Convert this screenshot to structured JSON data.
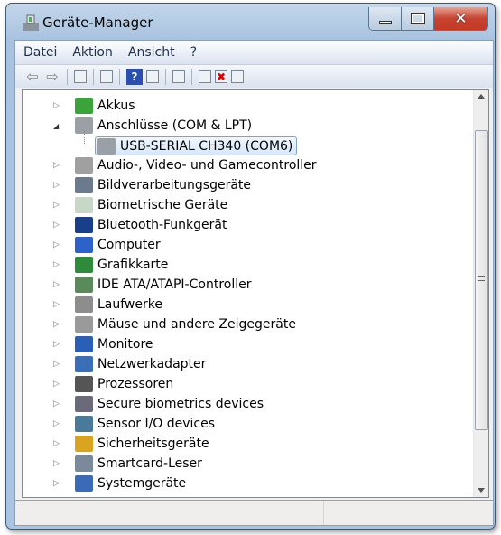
{
  "window": {
    "title": "Geräte-Manager"
  },
  "menu": [
    "Datei",
    "Aktion",
    "Ansicht",
    "?"
  ],
  "toolbar": [
    "back-icon",
    "forward-icon",
    "show-hide-console-tree-icon",
    "properties-icon",
    "help-icon",
    "show-action-pane-icon",
    "scan-hardware-icon",
    "update-driver-icon",
    "uninstall-icon",
    "disable-icon"
  ],
  "tree": [
    {
      "label": "Akkus",
      "expanded": false,
      "icon": "battery-icon",
      "color": "#3aa43a"
    },
    {
      "label": "Anschlüsse (COM & LPT)",
      "expanded": true,
      "icon": "port-icon",
      "color": "#9aa0a6",
      "children": [
        {
          "label": "USB-SERIAL CH340 (COM6)",
          "selected": true
        }
      ]
    },
    {
      "label": "Audio-, Video- und Gamecontroller",
      "expanded": false,
      "icon": "speaker-icon",
      "color": "#a0a0a0"
    },
    {
      "label": "Bildverarbeitungsgeräte",
      "expanded": false,
      "icon": "camera-icon",
      "color": "#6b7a8c"
    },
    {
      "label": "Biometrische Geräte",
      "expanded": false,
      "icon": "fingerprint-icon",
      "color": "#c8d8c8"
    },
    {
      "label": "Bluetooth-Funkgerät",
      "expanded": false,
      "icon": "bluetooth-icon",
      "color": "#1a3f8a"
    },
    {
      "label": "Computer",
      "expanded": false,
      "icon": "computer-icon",
      "color": "#2d62c8"
    },
    {
      "label": "Grafikkarte",
      "expanded": false,
      "icon": "display-adapter-icon",
      "color": "#2f8a3a"
    },
    {
      "label": "IDE ATA/ATAPI-Controller",
      "expanded": false,
      "icon": "ide-controller-icon",
      "color": "#5a8a5a"
    },
    {
      "label": "Laufwerke",
      "expanded": false,
      "icon": "disk-drive-icon",
      "color": "#8d8d8d"
    },
    {
      "label": "Mäuse und andere Zeigegeräte",
      "expanded": false,
      "icon": "mouse-icon",
      "color": "#9a9a9a"
    },
    {
      "label": "Monitore",
      "expanded": false,
      "icon": "monitor-icon",
      "color": "#2b5fb5"
    },
    {
      "label": "Netzwerkadapter",
      "expanded": false,
      "icon": "network-icon",
      "color": "#3a6fb8"
    },
    {
      "label": "Prozessoren",
      "expanded": false,
      "icon": "processor-icon",
      "color": "#555555"
    },
    {
      "label": "Secure biometrics devices",
      "expanded": false,
      "icon": "secure-biometrics-icon",
      "color": "#6a6a7a"
    },
    {
      "label": "Sensor I/O devices",
      "expanded": false,
      "icon": "sensor-icon",
      "color": "#4a7a9a"
    },
    {
      "label": "Sicherheitsgeräte",
      "expanded": false,
      "icon": "key-icon",
      "color": "#d9a520"
    },
    {
      "label": "Smartcard-Leser",
      "expanded": false,
      "icon": "smartcard-reader-icon",
      "color": "#7a8a9a"
    },
    {
      "label": "Systemgeräte",
      "expanded": false,
      "icon": "system-devices-icon",
      "color": "#3a6ab8"
    }
  ]
}
